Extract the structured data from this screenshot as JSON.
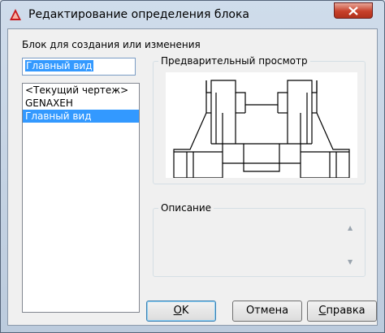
{
  "window": {
    "title": "Редактирование определения блока"
  },
  "block_section": {
    "label": "Блок для создания или изменения",
    "name_value": "Главный вид",
    "list": [
      "<Текущий чертеж>",
      "GENAXEH",
      "Главный вид"
    ],
    "selected": "Главный вид"
  },
  "preview": {
    "label": "Предварительный просмотр"
  },
  "description": {
    "label": "Описание",
    "value": ""
  },
  "buttons": {
    "ok": {
      "mnemonic": "O",
      "rest": "K"
    },
    "cancel": {
      "mnemonic": "",
      "rest": "Отмена"
    },
    "help": {
      "mnemonic": "С",
      "rest": "правка"
    }
  },
  "colors": {
    "selection": "#3399ff",
    "titlebar": "#c5d4e6",
    "close": "#c7402a",
    "app_icon": "#c8191c"
  }
}
